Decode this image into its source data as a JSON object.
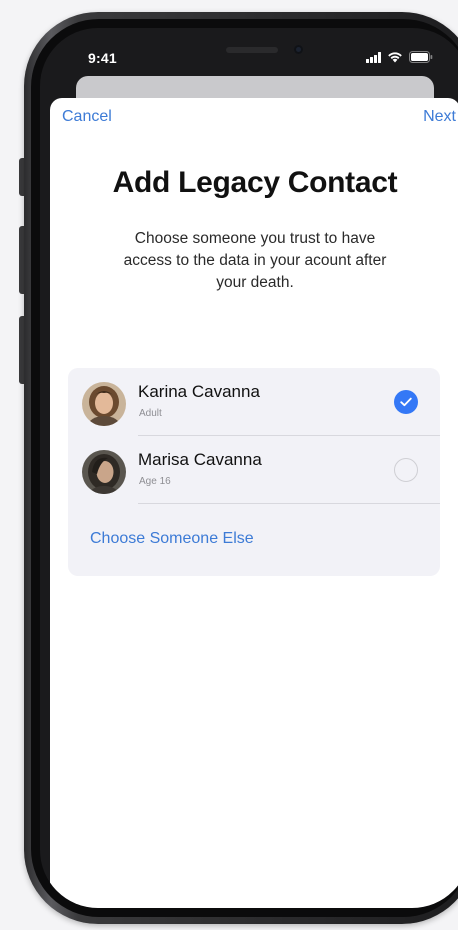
{
  "status_bar": {
    "time": "9:41",
    "signal_icon": "signal-bars-icon",
    "wifi_icon": "wifi-icon",
    "battery_icon": "battery-icon"
  },
  "nav": {
    "cancel_label": "Cancel",
    "next_label": "Next"
  },
  "header": {
    "title": "Add Legacy Contact",
    "subtitle": "Choose someone you trust to have access to the data in your acount after your death."
  },
  "contacts": [
    {
      "name": "Karina Cavanna",
      "detail": "Adult",
      "selected": true
    },
    {
      "name": "Marisa Cavanna",
      "detail": "Age 16",
      "selected": false
    }
  ],
  "choose_else_label": "Choose Someone Else",
  "colors": {
    "accent": "#3d7bd6",
    "check_blue": "#3478f6",
    "list_background": "#f2f2f7"
  }
}
